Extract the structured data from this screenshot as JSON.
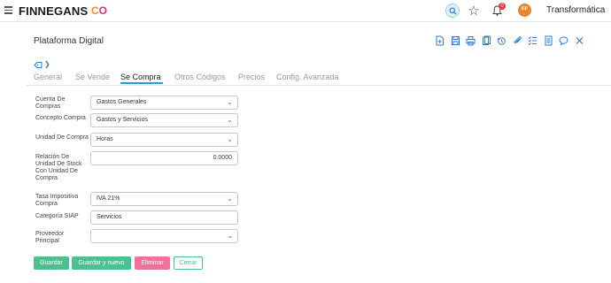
{
  "header": {
    "brand": "FINNEGANS",
    "brand_co_1": "C",
    "brand_co_2": "O",
    "notification_count": "0",
    "avatar_initials": "FF",
    "company": "Transformática"
  },
  "page": {
    "title": "Plataforma Digital"
  },
  "tabs": [
    {
      "label": "General"
    },
    {
      "label": "Se Vende"
    },
    {
      "label": "Se Compra"
    },
    {
      "label": "Otros Códigos"
    },
    {
      "label": "Precios"
    },
    {
      "label": "Config. Avanzada"
    }
  ],
  "active_tab": "Se Compra",
  "form": {
    "cuenta_compras": {
      "label": "Cuenta De Compras",
      "value": "Gastos Generales"
    },
    "concepto_compra": {
      "label": "Concepto Compra",
      "value": "Gastos y Servicios"
    },
    "unidad_compra": {
      "label": "Unidad De Compra",
      "value": "Horas"
    },
    "relacion_unidad": {
      "label": "Relación De Unidad De Stock Con Unidad De Compra",
      "value": "0.0000"
    },
    "tasa_impositiva": {
      "label": "Tasa Impositiva Compra",
      "value": "IVA 21%"
    },
    "categoria_siap": {
      "label": "Categoría SIAP",
      "value": "Servicios"
    },
    "proveedor_principal": {
      "label": "Proveedor Principal",
      "value": ""
    }
  },
  "buttons": {
    "save": "Guardar",
    "save_new": "Guardar y nuevo",
    "delete": "Eliminar",
    "close": "Cerrar"
  },
  "colors": {
    "accent": "#2a7fd4",
    "tab_underline": "#2a9fd6",
    "save_green": "#4cc08e",
    "delete_pink": "#f0719a",
    "avatar_orange": "#e8862e"
  }
}
